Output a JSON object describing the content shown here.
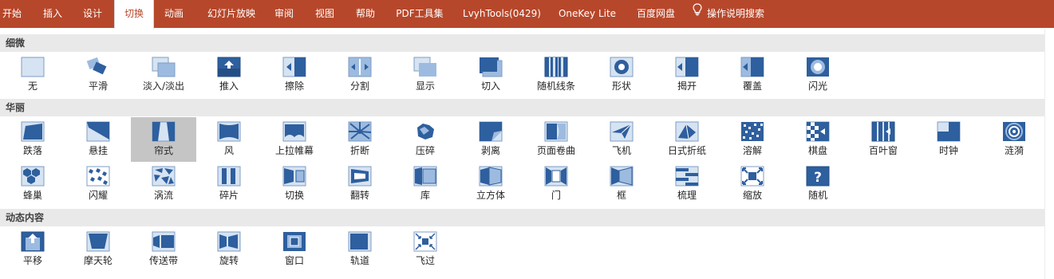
{
  "tabs": [
    "开始",
    "插入",
    "设计",
    "切换",
    "动画",
    "幻灯片放映",
    "审阅",
    "视图",
    "帮助",
    "PDF工具集",
    "LvyhTools(0429)",
    "OneKey Lite",
    "百度网盘",
    "操作说明搜索"
  ],
  "active_tab": "切换",
  "colors": {
    "ribbon": "#b7472a",
    "thumb_blue": "#2e5f9e",
    "section_bg": "#e9e9e9",
    "selected": "#c5c5c5"
  },
  "sections": {
    "subtle": {
      "title": "细微",
      "items": [
        "无",
        "平滑",
        "淡入/淡出",
        "推入",
        "擦除",
        "分割",
        "显示",
        "切入",
        "随机线条",
        "形状",
        "揭开",
        "覆盖",
        "闪光"
      ]
    },
    "exciting": {
      "title": "华丽",
      "items": [
        "跌落",
        "悬挂",
        "帘式",
        "风",
        "上拉帷幕",
        "折断",
        "压碎",
        "剥离",
        "页面卷曲",
        "飞机",
        "日式折纸",
        "溶解",
        "棋盘",
        "百叶窗",
        "时钟",
        "涟漪",
        "蜂巢",
        "闪耀",
        "涡流",
        "碎片",
        "切换",
        "翻转",
        "库",
        "立方体",
        "门",
        "框",
        "梳理",
        "缩放",
        "随机"
      ],
      "selected": "帘式"
    },
    "dynamic": {
      "title": "动态内容",
      "items": [
        "平移",
        "摩天轮",
        "传送带",
        "旋转",
        "窗口",
        "轨道",
        "飞过"
      ]
    }
  }
}
